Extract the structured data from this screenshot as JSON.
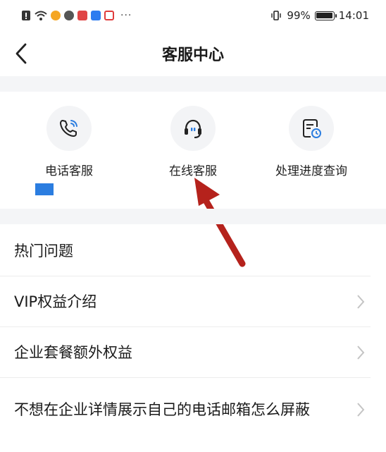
{
  "status_bar": {
    "dots": "···",
    "battery_percent": "99%",
    "battery_level": 0.99,
    "time": "14:01"
  },
  "header": {
    "title": "客服中心"
  },
  "services": [
    {
      "label": "电话客服",
      "icon": "phone-icon"
    },
    {
      "label": "在线客服",
      "icon": "headset-icon"
    },
    {
      "label": "处理进度查询",
      "icon": "progress-query-icon"
    }
  ],
  "faq": {
    "section_title": "热门问题",
    "items": [
      {
        "label": "VIP权益介绍"
      },
      {
        "label": "企业套餐额外权益"
      },
      {
        "label": "不想在企业详情展示自己的电话邮箱怎么屏蔽"
      }
    ]
  },
  "colors": {
    "annotation_arrow": "#b5221c",
    "accent_blue": "#2b7de0",
    "divider_gray": "#f4f5f7"
  }
}
